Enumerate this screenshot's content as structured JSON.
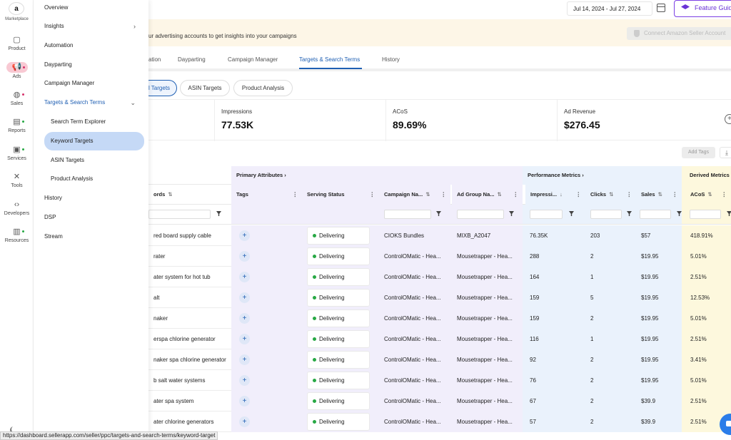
{
  "rail": {
    "marketplace_label": "Marketplace",
    "logo_letter": "a",
    "items": [
      {
        "label": "Product",
        "icon": "box-icon"
      },
      {
        "label": "Ads",
        "icon": "megaphone-icon"
      },
      {
        "label": "Sales",
        "icon": "globe-icon"
      },
      {
        "label": "Reports",
        "icon": "report-icon"
      },
      {
        "label": "Services",
        "icon": "briefcase-icon"
      },
      {
        "label": "Tools",
        "icon": "tools-icon"
      },
      {
        "label": "Developers",
        "icon": "code-icon"
      },
      {
        "label": "Resources",
        "icon": "book-icon"
      }
    ]
  },
  "menu": {
    "overview": "Overview",
    "insights": "Insights",
    "automation": "Automation",
    "dayparting": "Dayparting",
    "campaign_manager": "Campaign Manager",
    "targets": "Targets & Search Terms",
    "sub": {
      "search_term_explorer": "Search Term Explorer",
      "keyword_targets": "Keyword Targets",
      "asin_targets": "ASIN Targets",
      "product_analysis": "Product Analysis"
    },
    "history": "History",
    "dsp": "DSP",
    "stream": "Stream"
  },
  "topbar": {
    "date_range": "Jul 14, 2024 - Jul 27, 2024",
    "feature_button": "Feature Guide"
  },
  "banner": {
    "text": "ur advertising accounts to get insights into your campaigns",
    "connect_button": "Connect Amazon Seller Account"
  },
  "tabs": {
    "t1": "ation",
    "t2": "Dayparting",
    "t3": "Campaign Manager",
    "t4": "Targets & Search Terms",
    "t5": "History"
  },
  "pills": {
    "p1": "l Targets",
    "p2": "ASIN Targets",
    "p3": "Product Analysis"
  },
  "metrics": {
    "impressions_label": "Impressions",
    "impressions_value": "77.53K",
    "acos_label": "ACoS",
    "acos_value": "89.69%",
    "revenue_label": "Ad Revenue",
    "revenue_value": "$276.45"
  },
  "toolbar": {
    "add_tags": "Add Tags"
  },
  "table": {
    "groups": {
      "primary": "Primary Attributes",
      "performance": "Performance Metrics",
      "derived": "Derived Metrics"
    },
    "headers": {
      "keywords": "ords",
      "tags": "Tags",
      "serving_status": "Serving Status",
      "campaign_name": "Campaign Na...",
      "ad_group_name": "Ad Group Na...",
      "impressions": "Impressi...",
      "clicks": "Clicks",
      "sales": "Sales",
      "acos": "ACoS"
    },
    "rows": [
      {
        "kw": "red board supply cable",
        "status": "Delivering",
        "campaign": "CIOKS Bundles",
        "adgroup": "MIXB_A2047",
        "impr": "76.35K",
        "clicks": "203",
        "sales": "$57",
        "acos": "418.91%"
      },
      {
        "kw": "rater",
        "status": "Delivering",
        "campaign": "ControlOMatic - Hea...",
        "adgroup": "Mousetrapper - Hea...",
        "impr": "288",
        "clicks": "2",
        "sales": "$19.95",
        "acos": "5.01%"
      },
      {
        "kw": "ater system for hot tub",
        "status": "Delivering",
        "campaign": "ControlOMatic - Hea...",
        "adgroup": "Mousetrapper - Hea...",
        "impr": "164",
        "clicks": "1",
        "sales": "$19.95",
        "acos": "2.51%"
      },
      {
        "kw": "alt",
        "status": "Delivering",
        "campaign": "ControlOMatic - Hea...",
        "adgroup": "Mousetrapper - Hea...",
        "impr": "159",
        "clicks": "5",
        "sales": "$19.95",
        "acos": "12.53%"
      },
      {
        "kw": "naker",
        "status": "Delivering",
        "campaign": "ControlOMatic - Hea...",
        "adgroup": "Mousetrapper - Hea...",
        "impr": "159",
        "clicks": "2",
        "sales": "$19.95",
        "acos": "5.01%"
      },
      {
        "kw": "erspa chlorine generator",
        "status": "Delivering",
        "campaign": "ControlOMatic - Hea...",
        "adgroup": "Mousetrapper - Hea...",
        "impr": "116",
        "clicks": "1",
        "sales": "$19.95",
        "acos": "2.51%"
      },
      {
        "kw": "naker spa chlorine generator",
        "status": "Delivering",
        "campaign": "ControlOMatic - Hea...",
        "adgroup": "Mousetrapper - Hea...",
        "impr": "92",
        "clicks": "2",
        "sales": "$19.95",
        "acos": "3.41%"
      },
      {
        "kw": "b salt water systems",
        "status": "Delivering",
        "campaign": "ControlOMatic - Hea...",
        "adgroup": "Mousetrapper - Hea...",
        "impr": "76",
        "clicks": "2",
        "sales": "$19.95",
        "acos": "5.01%"
      },
      {
        "kw": "ater spa system",
        "status": "Delivering",
        "campaign": "ControlOMatic - Hea...",
        "adgroup": "Mousetrapper - Hea...",
        "impr": "67",
        "clicks": "2",
        "sales": "$39.9",
        "acos": "2.51%"
      },
      {
        "kw": "ater chlorine generators",
        "status": "Delivering",
        "campaign": "ControlOMatic - Hea...",
        "adgroup": "Mousetrapper - Hea...",
        "impr": "57",
        "clicks": "2",
        "sales": "$39.9",
        "acos": "2.51%"
      }
    ]
  },
  "status_url": "https://dashboard.sellerapp.com/seller/ppc/targets-and-search-terms/keyword-target",
  "colors": {
    "accent": "#1f5fb3",
    "feature": "#6a34d6",
    "delivering": "#27a844",
    "primary_bg": "#f1eefb",
    "performance_bg": "#eaf2fc",
    "derived_bg": "#fdf8dd"
  }
}
